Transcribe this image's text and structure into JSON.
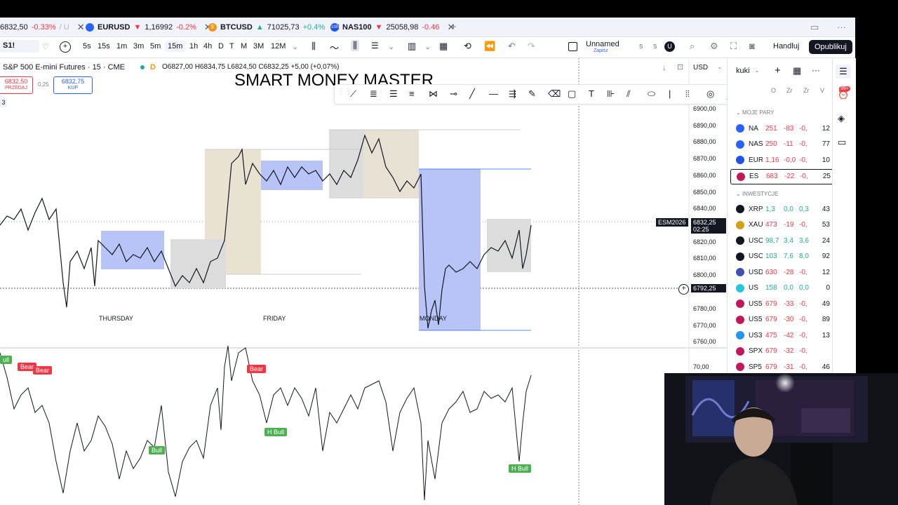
{
  "tabs": [
    {
      "symbol": "6832,50",
      "change": "-0.33%",
      "extra": "/ U",
      "dir": "down",
      "close": "✕"
    },
    {
      "symbol": "EURUSD",
      "price": "1,16992",
      "change": "-0.2%",
      "dir": "down",
      "close": "✕"
    },
    {
      "symbol": "BTCUSD",
      "price": "71025,73",
      "change": "+0.4%",
      "dir": "up",
      "close": "✕"
    },
    {
      "symbol": "NAS100",
      "price": "25058,98",
      "change": "-0.46",
      "dir": "down",
      "close": "✕"
    }
  ],
  "tabs_add": "+",
  "toolbar": {
    "symbol": "S1!",
    "intervals": [
      "5s",
      "15s",
      "1m",
      "3m",
      "5m",
      "15m",
      "1h",
      "4h",
      "D",
      "T",
      "M",
      "3M",
      "12M"
    ],
    "active_interval": "15m",
    "layout_name": "Unnamed",
    "layout_sub": "Zapisz",
    "s1": "s",
    "s2": "s",
    "u": "U",
    "trade": "Handluj",
    "publish": "Opublikuj"
  },
  "legend": {
    "title": "S&P 500 E-mini Futures · 15 · CME",
    "d_badge": "D",
    "ohlc": "O6827,00 H6834,75 L6824,50 C6832,25 +5,00 (+0,07%)",
    "sell_price": "6832,50",
    "sell_label": "PRZEDAJ",
    "spread": "0,25",
    "buy_price": "6832,75",
    "buy_label": "KUP",
    "count": "3"
  },
  "overlay_title": "SMART MONEY MASTER",
  "currency": "USD",
  "days": [
    "THURSDAY",
    "FRIDAY",
    "MONDAY"
  ],
  "price_axis": [
    "6900,00",
    "6890,00",
    "6880,00",
    "6870,00",
    "6860,00",
    "6850,00",
    "6840,00",
    "6830,00",
    "6820,00",
    "6810,00",
    "6800,00",
    "6790,00",
    "6780,00",
    "6770,00",
    "6760,00"
  ],
  "osc_axis": "70,00",
  "current": {
    "symbol": "ESM2026",
    "price": "6832,25",
    "time": "02:25"
  },
  "crosshair_price": "6792,25",
  "signals": {
    "bear1": "Bear",
    "bear2": "Bear",
    "bear3": "Bear",
    "bull1": "Bull",
    "hbull1": "H Bull",
    "hbull2": "H Bull",
    "bull0": "ull"
  },
  "watchlist": {
    "name": "kuki",
    "cols": [
      "O",
      "Zr",
      "Zr",
      "V"
    ],
    "section1": "MOJE PARY",
    "section2": "INWESTYCJE",
    "rows1": [
      {
        "sym": "NA",
        "p": "251",
        "c": "-83",
        "cp": "-0,",
        "v": "12"
      },
      {
        "sym": "NAS",
        "p": "250",
        "c": "-11",
        "cp": "-0,",
        "v": "77"
      },
      {
        "sym": "EUR",
        "p": "1,16",
        "c": "-0,0",
        "cp": "-0,",
        "v": "10"
      },
      {
        "sym": "ES",
        "p": "683",
        "c": "-22",
        "cp": "-0,",
        "v": "25"
      }
    ],
    "rows2": [
      {
        "sym": "XRP",
        "p": "1,3",
        "c": "0,0",
        "cp": "0,3",
        "v": "43"
      },
      {
        "sym": "XAU",
        "p": "473",
        "c": "-19",
        "cp": "-0,",
        "v": "53"
      },
      {
        "sym": "USO",
        "p": "98,7",
        "c": "3,4",
        "cp": "3,6",
        "v": "24"
      },
      {
        "sym": "USO",
        "p": "103",
        "c": "7,6",
        "cp": "8,0",
        "v": "92"
      },
      {
        "sym": "USD",
        "p": "630",
        "c": "-28",
        "cp": "-0,",
        "v": "12"
      },
      {
        "sym": "US",
        "p": "158",
        "c": "0,0",
        "cp": "0,0",
        "v": "0"
      },
      {
        "sym": "US5",
        "p": "679",
        "c": "-33",
        "cp": "-0,",
        "v": "49"
      },
      {
        "sym": "US5",
        "p": "679",
        "c": "-30",
        "cp": "-0,",
        "v": "89"
      },
      {
        "sym": "US3",
        "p": "475",
        "c": "-42",
        "cp": "-0,",
        "v": "13"
      },
      {
        "sym": "SPX",
        "p": "679",
        "c": "-32",
        "cp": "-0,",
        "v": ""
      },
      {
        "sym": "SP5",
        "p": "679",
        "c": "-31",
        "cp": "-0,",
        "v": "46"
      }
    ]
  },
  "notif_badge": "99+",
  "colors": {
    "accent": "#2962ff",
    "down": "#f23645",
    "up": "#22ab94",
    "blue_box": "#b8c4f5",
    "tan_box": "#e8e2d0",
    "gray_box": "#dcdcdc"
  }
}
